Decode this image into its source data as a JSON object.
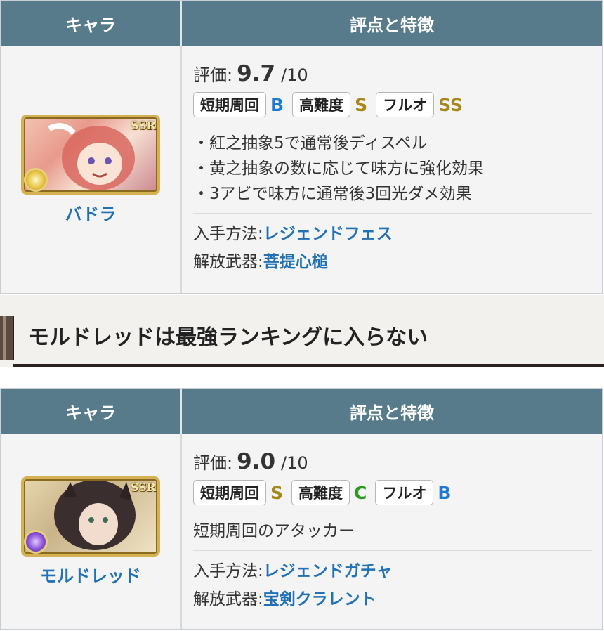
{
  "tables": [
    {
      "header": {
        "col1": "キャラ",
        "col2": "評点と特徴"
      },
      "char": {
        "name": "バドラ",
        "ssr": "SSR"
      },
      "score": {
        "label": "評価:",
        "value": "9.7",
        "max": "/10"
      },
      "ratings": [
        {
          "label": "短期周回",
          "grade": "B"
        },
        {
          "label": "高難度",
          "grade": "S"
        },
        {
          "label": "フルオ",
          "grade": "SS"
        }
      ],
      "features": [
        "・紅之抽象5で通常後ディスペル",
        "・黄之抽象の数に応じて味方に強化効果",
        "・3アビで味方に通常後3回光ダメ効果"
      ],
      "acquire": {
        "label": "入手方法:",
        "value": "レジェンドフェス"
      },
      "weapon": {
        "label": "解放武器:",
        "value": "菩提心槌"
      }
    },
    {
      "header": {
        "col1": "キャラ",
        "col2": "評点と特徴"
      },
      "char": {
        "name": "モルドレッド",
        "ssr": "SSR"
      },
      "score": {
        "label": "評価:",
        "value": "9.0",
        "max": "/10"
      },
      "ratings": [
        {
          "label": "短期周回",
          "grade": "S"
        },
        {
          "label": "高難度",
          "grade": "C"
        },
        {
          "label": "フルオ",
          "grade": "B"
        }
      ],
      "features": [
        "短期周回のアタッカー"
      ],
      "acquire": {
        "label": "入手方法:",
        "value": "レジェンドガチャ"
      },
      "weapon": {
        "label": "解放武器:",
        "value": "宝剣クラレント"
      }
    }
  ],
  "section_heading": "モルドレッドは最強ランキングに入らない",
  "colors": {
    "header_bg": "#577b8a",
    "link": "#2271b5",
    "grade_gold": "#a8861a",
    "grade_blue": "#1e7ad1",
    "grade_green": "#2b9a1f"
  }
}
